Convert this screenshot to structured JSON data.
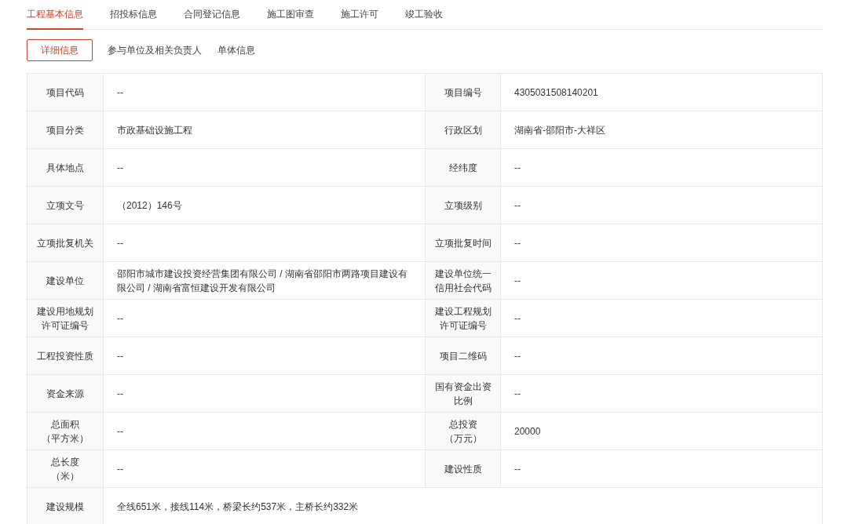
{
  "tabs": [
    {
      "label": "工程基本信息",
      "selected": true
    },
    {
      "label": "招投标信息",
      "selected": false
    },
    {
      "label": "合同登记信息",
      "selected": false
    },
    {
      "label": "施工图审查",
      "selected": false
    },
    {
      "label": "施工许可",
      "selected": false
    },
    {
      "label": "竣工验收",
      "selected": false
    }
  ],
  "subtabs": [
    {
      "label": "详细信息",
      "selected": true
    },
    {
      "label": "参与单位及相关负责人",
      "selected": false
    },
    {
      "label": "单体信息",
      "selected": false
    }
  ],
  "rows": [
    {
      "fields": [
        {
          "label": "项目代码",
          "value": "--"
        },
        {
          "label": "项目编号",
          "value": "4305031508140201"
        }
      ]
    },
    {
      "fields": [
        {
          "label": "项目分类",
          "value": "市政基础设施工程"
        },
        {
          "label": "行政区划",
          "value": "湖南省-邵阳市-大祥区"
        }
      ]
    },
    {
      "fields": [
        {
          "label": "具体地点",
          "value": "--"
        },
        {
          "label": "经纬度",
          "value": "--"
        }
      ]
    },
    {
      "fields": [
        {
          "label": "立项文号",
          "value": "（2012）146号"
        },
        {
          "label": "立项级别",
          "value": "--"
        }
      ]
    },
    {
      "fields": [
        {
          "label": "立项批复机关",
          "value": "--"
        },
        {
          "label": "立项批复时间",
          "value": "--"
        }
      ]
    },
    {
      "fields": [
        {
          "label": "建设单位",
          "value": "邵阳市城市建设投资经营集团有限公司 / 湖南省邵阳市两路项目建设有限公司 / 湖南省富恒建设开发有限公司"
        },
        {
          "label": "建设单位统一信用社会代码",
          "value": "--"
        }
      ]
    },
    {
      "fields": [
        {
          "label": "建设用地规划许可证编号",
          "value": "--"
        },
        {
          "label": "建设工程规划许可证编号",
          "value": "--"
        }
      ]
    },
    {
      "fields": [
        {
          "label": "工程投资性质",
          "value": "--"
        },
        {
          "label": "项目二维码",
          "value": "--"
        }
      ]
    },
    {
      "fields": [
        {
          "label": "资金来源",
          "value": "--"
        },
        {
          "label": "国有资金出资比例",
          "value": "--"
        }
      ]
    },
    {
      "fields": [
        {
          "label": "总面积（平方米）",
          "value": "--"
        },
        {
          "label": "总投资（万元）",
          "value": "20000"
        }
      ]
    },
    {
      "fields": [
        {
          "label": "总长度（米）",
          "value": "--"
        },
        {
          "label": "建设性质",
          "value": "--"
        }
      ]
    },
    {
      "fields": [
        {
          "label": "建设规模",
          "value": "全线651米，接线114米，桥梁长约537米，主桥长约332米"
        }
      ]
    }
  ]
}
